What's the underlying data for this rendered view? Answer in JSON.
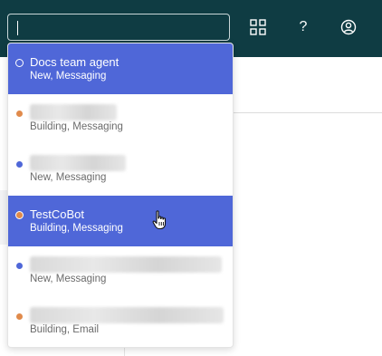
{
  "search": {
    "value": "",
    "placeholder": ""
  },
  "header": {
    "icons": [
      "grid-icon",
      "help-icon",
      "account-icon"
    ],
    "help_glyph": "?"
  },
  "dropdown": {
    "items": [
      {
        "name": "Docs team agent",
        "sub": "New, Messaging",
        "selected": true,
        "dot": "hollow"
      },
      {
        "name": "",
        "sub": "Building, Messaging",
        "selected": false,
        "dot": "#e08a4b"
      },
      {
        "name": "",
        "sub": "New, Messaging",
        "selected": false,
        "dot": "#4f67d8"
      },
      {
        "name": "TestCoBot",
        "sub": "Building, Messaging",
        "selected": true,
        "dot": "#e08a4b"
      },
      {
        "name": "",
        "sub": "New, Messaging",
        "selected": false,
        "dot": "#4f67d8"
      },
      {
        "name": "",
        "sub": "Building, Email",
        "selected": false,
        "dot": "#e08a4b"
      }
    ]
  },
  "colors": {
    "header_bg": "#0f3c43",
    "selected_bg": "#4f67d8",
    "status_building": "#e08a4b",
    "status_new": "#4f67d8"
  }
}
